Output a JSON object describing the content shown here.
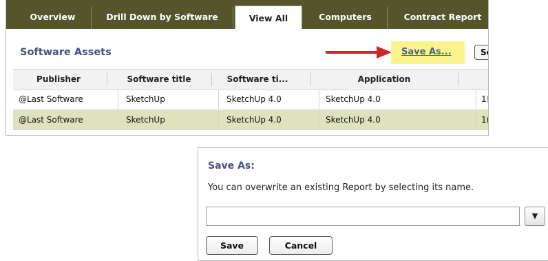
{
  "tabs": [
    {
      "label": "Overview"
    },
    {
      "label": "Drill Down by Software"
    },
    {
      "label": "View All"
    },
    {
      "label": "Computers"
    },
    {
      "label": "Contract Report"
    }
  ],
  "section_title": "Software Assets",
  "saveas_link": "Save As...",
  "partial_button": "Se",
  "table": {
    "headers": [
      "Publisher",
      "Software title",
      "Software ti...",
      "Application"
    ],
    "rows": [
      [
        "@Last Software",
        "SketchUp",
        "SketchUp 4.0",
        "SketchUp 4.0",
        "1!"
      ],
      [
        "@Last Software",
        "SketchUp",
        "SketchUp 4.0",
        "SketchUp 4.0",
        "1("
      ]
    ]
  },
  "dialog": {
    "title": "Save As:",
    "hint": "You can overwrite an existing Report by selecting its name.",
    "input_value": "",
    "dropdown_glyph": "▼",
    "save_label": "Save",
    "cancel_label": "Cancel"
  },
  "colors": {
    "tabbar": "#54552a",
    "title": "#45508a",
    "highlight": "#fbf48c",
    "row_alt": "#dfe3bd",
    "arrow": "#d9202a"
  }
}
